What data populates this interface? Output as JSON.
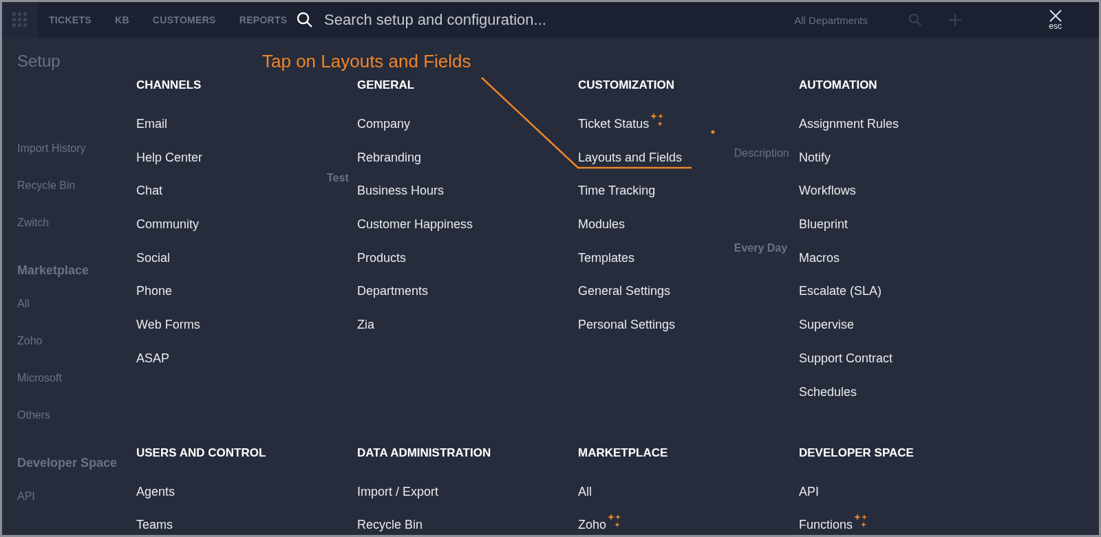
{
  "background": {
    "nav": [
      "TICKETS",
      "KB",
      "CUSTOMERS",
      "REPORTS"
    ],
    "departments": "All Departments",
    "title": "Setup",
    "sidebar": [
      {
        "label": "Import History",
        "kind": "item"
      },
      {
        "label": "Recycle Bin",
        "kind": "item"
      },
      {
        "label": "Zwitch",
        "kind": "item"
      },
      {
        "label": "Marketplace",
        "kind": "heading"
      },
      {
        "label": "All",
        "kind": "item"
      },
      {
        "label": "Zoho",
        "kind": "item"
      },
      {
        "label": "Microsoft",
        "kind": "item"
      },
      {
        "label": "Others",
        "kind": "item"
      },
      {
        "label": "Developer Space",
        "kind": "heading"
      },
      {
        "label": "API",
        "kind": "item"
      }
    ],
    "fields": [
      {
        "label": "Description",
        "value": "Every Day"
      }
    ],
    "schedule_value": "Test"
  },
  "search": {
    "placeholder": "Search setup and configuration..."
  },
  "close": {
    "label": "esc"
  },
  "annotation": {
    "text": "Tap on Layouts and Fields"
  },
  "sections": [
    {
      "title": "CHANNELS",
      "items": [
        {
          "label": "Email",
          "new": false
        },
        {
          "label": "Help Center",
          "new": false
        },
        {
          "label": "Chat",
          "new": false
        },
        {
          "label": "Community",
          "new": false
        },
        {
          "label": "Social",
          "new": false
        },
        {
          "label": "Phone",
          "new": false
        },
        {
          "label": "Web Forms",
          "new": false
        },
        {
          "label": "ASAP",
          "new": false
        }
      ]
    },
    {
      "title": "GENERAL",
      "items": [
        {
          "label": "Company",
          "new": false
        },
        {
          "label": "Rebranding",
          "new": false
        },
        {
          "label": "Business Hours",
          "new": false
        },
        {
          "label": "Customer Happiness",
          "new": false
        },
        {
          "label": "Products",
          "new": false
        },
        {
          "label": "Departments",
          "new": false
        },
        {
          "label": "Zia",
          "new": false
        }
      ]
    },
    {
      "title": "CUSTOMIZATION",
      "items": [
        {
          "label": "Ticket Status",
          "new": true
        },
        {
          "label": "Layouts and Fields",
          "new": false
        },
        {
          "label": "Time Tracking",
          "new": false
        },
        {
          "label": "Modules",
          "new": false
        },
        {
          "label": "Templates",
          "new": false
        },
        {
          "label": "General Settings",
          "new": false
        },
        {
          "label": "Personal Settings",
          "new": false
        }
      ]
    },
    {
      "title": "AUTOMATION",
      "items": [
        {
          "label": "Assignment Rules",
          "new": false
        },
        {
          "label": "Notify",
          "new": false
        },
        {
          "label": "Workflows",
          "new": false
        },
        {
          "label": "Blueprint",
          "new": false
        },
        {
          "label": "Macros",
          "new": false
        },
        {
          "label": "Escalate (SLA)",
          "new": false
        },
        {
          "label": "Supervise",
          "new": false
        },
        {
          "label": "Support Contract",
          "new": false
        },
        {
          "label": "Schedules",
          "new": false
        }
      ]
    },
    {
      "title": "USERS AND CONTROL",
      "items": [
        {
          "label": "Agents",
          "new": false
        },
        {
          "label": "Teams",
          "new": false
        }
      ]
    },
    {
      "title": "DATA ADMINISTRATION",
      "items": [
        {
          "label": "Import / Export",
          "new": false
        },
        {
          "label": "Recycle Bin",
          "new": false
        }
      ]
    },
    {
      "title": "MARKETPLACE",
      "items": [
        {
          "label": "All",
          "new": false
        },
        {
          "label": "Zoho",
          "new": true
        }
      ]
    },
    {
      "title": "DEVELOPER SPACE",
      "items": [
        {
          "label": "API",
          "new": false
        },
        {
          "label": "Functions",
          "new": true
        }
      ]
    }
  ]
}
